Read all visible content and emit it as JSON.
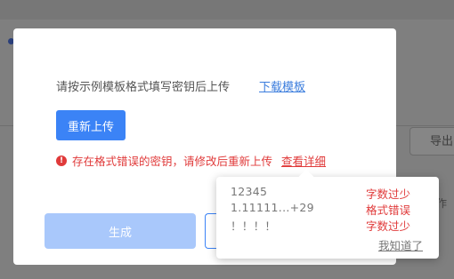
{
  "background": {
    "export_label": "导出",
    "right_text": "作"
  },
  "dialog": {
    "instruction": "请按示例模板格式填写密钥后上传",
    "download_link": "下载模板",
    "reupload_button": "重新上传",
    "error_message": "存在格式错误的密钥，请修改后重新上传",
    "view_details_link": "查看详细",
    "generate_button": "生成"
  },
  "error_popover": {
    "rows": [
      {
        "value": "12345",
        "error": "字数过少"
      },
      {
        "value": "1.11111...+29",
        "error": "格式错误"
      },
      {
        "value": "！！！！",
        "error": "字数过少"
      }
    ],
    "dismiss_label": "我知道了"
  },
  "colors": {
    "primary": "#3b83f6",
    "primary_disabled": "#a9c8fb",
    "error": "#e03a3a",
    "link": "#3b7ddd"
  },
  "icons": {
    "error": "error-circle-icon"
  }
}
